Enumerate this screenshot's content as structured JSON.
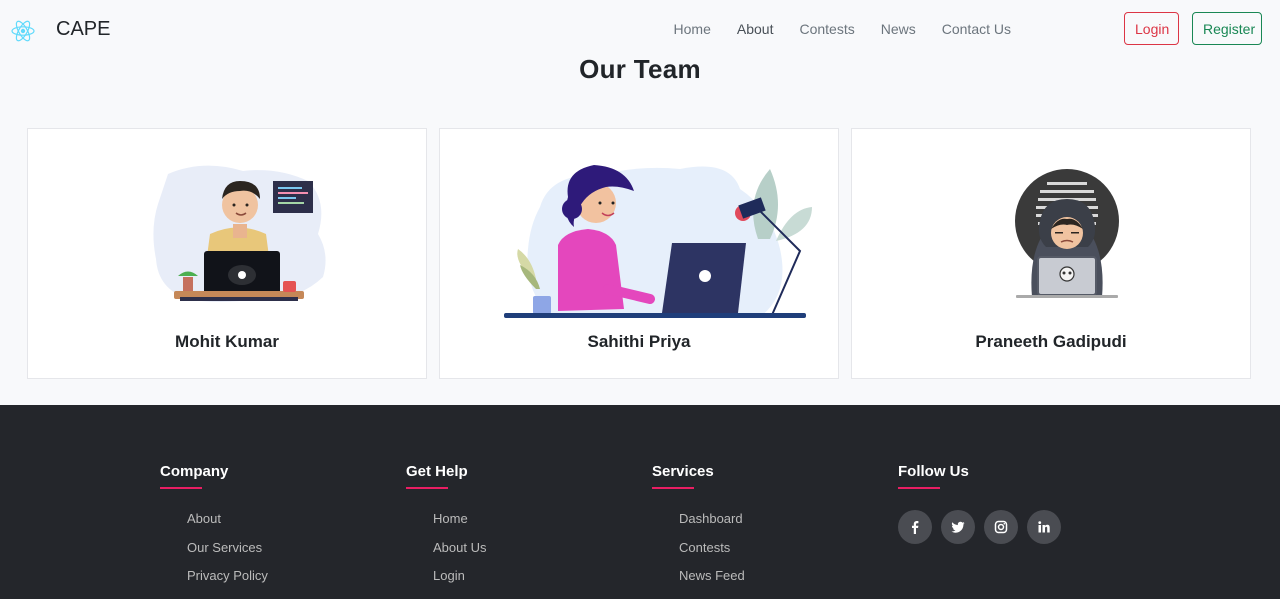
{
  "brand": {
    "name": "CAPE",
    "icon": "react-atom-icon",
    "icon_color": "#61dafb"
  },
  "nav": {
    "links": [
      "Home",
      "About",
      "Contests",
      "News",
      "Contact Us"
    ],
    "active": "About",
    "login_label": "Login",
    "register_label": "Register"
  },
  "colors": {
    "login": "#dc3545",
    "register": "#198754",
    "footer_bg": "#24262b",
    "accent": "#e91e63"
  },
  "team": {
    "title": "Our Team",
    "members": [
      {
        "name": "Mohit Kumar",
        "illustration": "developer-at-desk-illustration"
      },
      {
        "name": "Sahithi Priya",
        "illustration": "woman-with-laptop-illustration"
      },
      {
        "name": "Praneeth Gadipudi",
        "illustration": "hooded-hacker-illustration"
      }
    ]
  },
  "footer": {
    "columns": [
      {
        "heading": "Company",
        "links": [
          "About",
          "Our Services",
          "Privacy Policy"
        ]
      },
      {
        "heading": "Get Help",
        "links": [
          "Home",
          "About Us",
          "Login"
        ]
      },
      {
        "heading": "Services",
        "links": [
          "Dashboard",
          "Contests",
          "News Feed"
        ]
      }
    ],
    "follow": {
      "heading": "Follow Us",
      "icons": [
        "facebook-icon",
        "twitter-icon",
        "instagram-icon",
        "linkedin-icon"
      ]
    }
  }
}
